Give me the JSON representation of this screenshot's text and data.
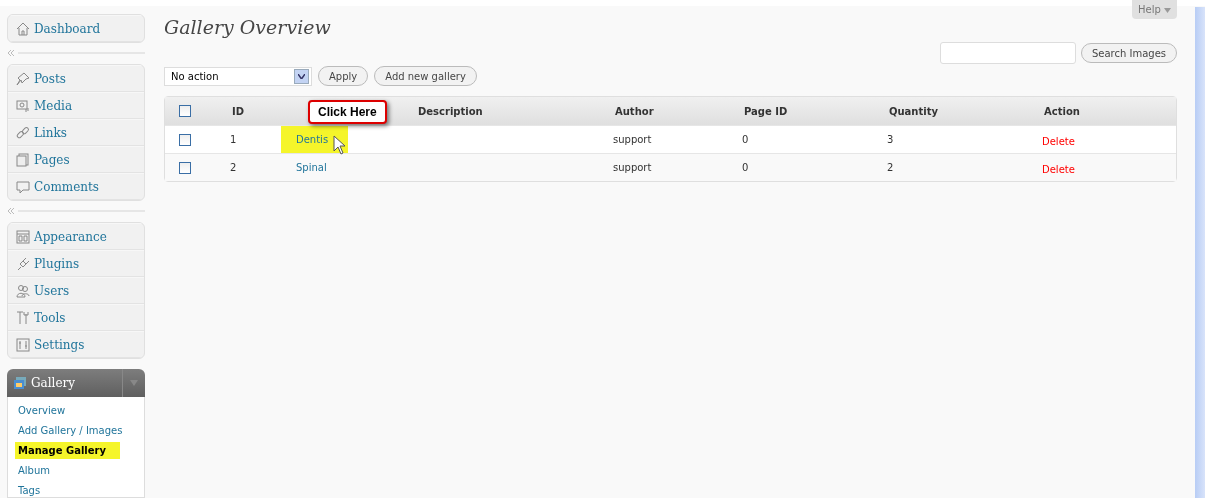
{
  "sidebar": {
    "groups": [
      {
        "items": [
          {
            "label": "Dashboard"
          }
        ]
      },
      {
        "items": [
          {
            "label": "Posts"
          },
          {
            "label": "Media"
          },
          {
            "label": "Links"
          },
          {
            "label": "Pages"
          },
          {
            "label": "Comments"
          }
        ]
      },
      {
        "items": [
          {
            "label": "Appearance"
          },
          {
            "label": "Plugins"
          },
          {
            "label": "Users"
          },
          {
            "label": "Tools"
          },
          {
            "label": "Settings"
          }
        ]
      }
    ],
    "gallery": {
      "label": "Gallery",
      "expanded": true,
      "items": [
        {
          "label": "Overview",
          "selected": false,
          "highlighted": false
        },
        {
          "label": "Add Gallery / Images",
          "selected": false,
          "highlighted": false
        },
        {
          "label": "Manage Gallery",
          "selected": true,
          "highlighted": true
        },
        {
          "label": "Album",
          "selected": false,
          "highlighted": false
        },
        {
          "label": "Tags",
          "selected": false,
          "highlighted": false
        }
      ]
    }
  },
  "help": "Help",
  "title": "Gallery Overview",
  "search": {
    "button": "Search Images"
  },
  "bulk": {
    "value": "No action",
    "apply": "Apply",
    "add": "Add new gallery"
  },
  "table": {
    "select_all": {
      "checked": false
    },
    "columns": [
      "ID",
      "",
      "Description",
      "Author",
      "Page ID",
      "Quantity",
      "Action"
    ],
    "rows": [
      {
        "checked": false,
        "id": "1",
        "name": "Dentis",
        "highlighted": true,
        "author": "support",
        "page_id": "0",
        "quantity": "3",
        "action": "Delete"
      },
      {
        "checked": false,
        "id": "2",
        "name": "Spinal",
        "highlighted": false,
        "author": "support",
        "page_id": "0",
        "quantity": "2",
        "action": "Delete"
      }
    ]
  },
  "callout": {
    "text": "Click Here"
  }
}
